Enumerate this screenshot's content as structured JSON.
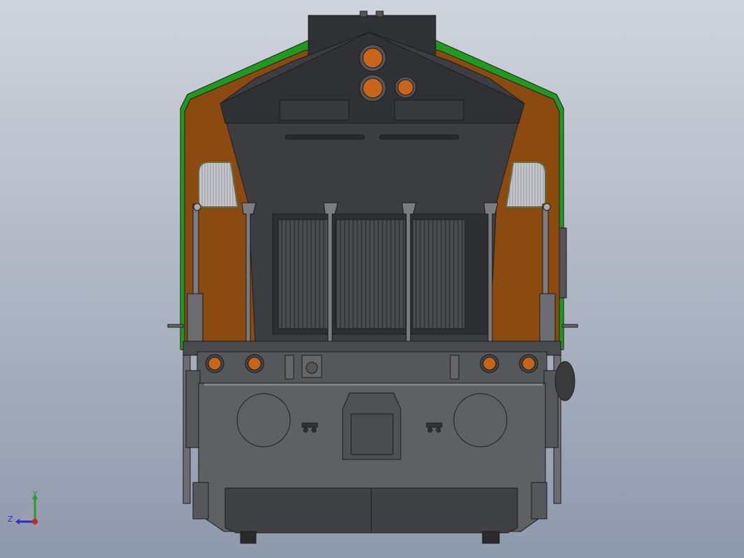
{
  "viewport": {
    "background_top": "#c9ced8",
    "background_bottom": "#8f99ac"
  },
  "colors": {
    "body_dark": "#3b3d41",
    "body_darker": "#2c2e31",
    "body_mid": "#58595c",
    "pilot_gray": "#5e6064",
    "stripe_green": "#1f9a1f",
    "panel_orange": "#8a4a10",
    "light_amber": "#c9651b",
    "window_gray": "#b6b8be",
    "outline": "#1c1c1c"
  },
  "model": {
    "name": "locomotive-front-view",
    "lights": [
      "headlight-top",
      "headlight-lower",
      "marker-small",
      "ditch-left-1",
      "ditch-left-2",
      "ditch-right-1",
      "ditch-right-2"
    ]
  },
  "triad": {
    "y_label": "Y",
    "z_label": "Z",
    "y_color": "#2a9a2a",
    "z_color": "#2a2ad0",
    "x_color": "#d02020"
  }
}
